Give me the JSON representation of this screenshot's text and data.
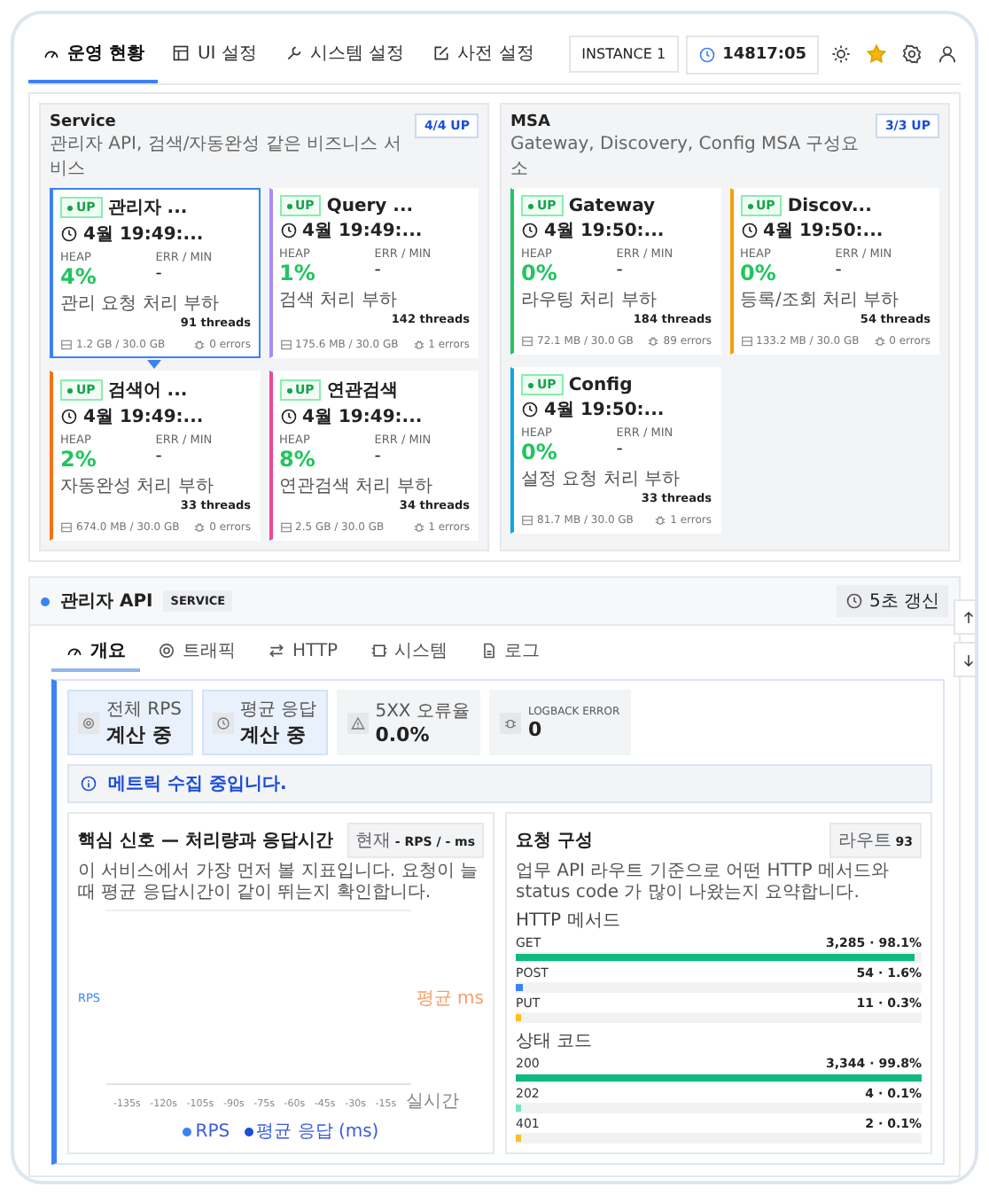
{
  "nav": {
    "tabs": [
      {
        "label": "운영 현황",
        "selected": true
      },
      {
        "label": "UI 설정",
        "selected": false
      },
      {
        "label": "시스템 설정",
        "selected": false
      },
      {
        "label": "사전 설정",
        "selected": false
      }
    ],
    "instance": "INSTANCE 1",
    "clock": "14817:05",
    "favorite": true
  },
  "groups": [
    {
      "title": "Service",
      "description": "관리자 API, 검색/자동완성 같은 비즈니스 서비스",
      "badge": "4/4 UP",
      "services": [
        {
          "status": "UP",
          "name": "관리자 ...",
          "time": "4월 19:49:...",
          "heap_label": "HEAP",
          "heap": "4%",
          "err_label": "ERR / MIN",
          "err": "-",
          "load": "관리 요청 처리 부하",
          "threads": "91 threads",
          "memory": "1.2 GB / 30.0 GB",
          "errors": "0 errors",
          "color": "#3b82f6",
          "selected": true
        },
        {
          "status": "UP",
          "name": "Query ...",
          "time": "4월 19:49:...",
          "heap_label": "HEAP",
          "heap": "1%",
          "err_label": "ERR / MIN",
          "err": "-",
          "load": "검색 처리 부하",
          "threads": "142 threads",
          "memory": "175.6 MB / 30.0 GB",
          "errors": "1 errors",
          "color": "#a78bfa",
          "selected": false
        },
        {
          "status": "UP",
          "name": "검색어 ...",
          "time": "4월 19:49:...",
          "heap_label": "HEAP",
          "heap": "2%",
          "err_label": "ERR / MIN",
          "err": "-",
          "load": "자동완성 처리 부하",
          "threads": "33 threads",
          "memory": "674.0 MB / 30.0 GB",
          "errors": "0 errors",
          "color": "#f97316",
          "selected": false
        },
        {
          "status": "UP",
          "name": "연관검색",
          "time": "4월 19:49:...",
          "heap_label": "HEAP",
          "heap": "8%",
          "err_label": "ERR / MIN",
          "err": "-",
          "load": "연관검색 처리 부하",
          "threads": "34 threads",
          "memory": "2.5 GB / 30.0 GB",
          "errors": "1 errors",
          "color": "#ec4899",
          "selected": false
        }
      ]
    },
    {
      "title": "MSA",
      "description": "Gateway, Discovery, Config MSA 구성요소",
      "badge": "3/3 UP",
      "services": [
        {
          "status": "UP",
          "name": "Gateway",
          "time": "4월 19:50:...",
          "heap_label": "HEAP",
          "heap": "0%",
          "err_label": "ERR / MIN",
          "err": "-",
          "load": "라우팅 처리 부하",
          "threads": "184 threads",
          "memory": "72.1 MB / 30.0 GB",
          "errors": "89 errors",
          "color": "#22c55e",
          "selected": false
        },
        {
          "status": "UP",
          "name": "Discov...",
          "time": "4월 19:50:...",
          "heap_label": "HEAP",
          "heap": "0%",
          "err_label": "ERR / MIN",
          "err": "-",
          "load": "등록/조회 처리 부하",
          "threads": "54 threads",
          "memory": "133.2 MB / 30.0 GB",
          "errors": "0 errors",
          "color": "#f59e0b",
          "selected": false
        },
        {
          "status": "UP",
          "name": "Config",
          "time": "4월 19:50:...",
          "heap_label": "HEAP",
          "heap": "0%",
          "err_label": "ERR / MIN",
          "err": "-",
          "load": "설정 요청 처리 부하",
          "threads": "33 threads",
          "memory": "81.7 MB / 30.0 GB",
          "errors": "1 errors",
          "color": "#0ea5e9",
          "selected": false
        }
      ]
    }
  ],
  "detail": {
    "title": "관리자 API",
    "tag": "SERVICE",
    "refresh": "5초 갱신",
    "tabs": [
      {
        "label": "개요",
        "selected": true
      },
      {
        "label": "트래픽",
        "selected": false
      },
      {
        "label": "HTTP",
        "selected": false
      },
      {
        "label": "시스템",
        "selected": false
      },
      {
        "label": "로그",
        "selected": false
      }
    ],
    "stats": [
      {
        "label": "전체 RPS",
        "value": "계산 중",
        "highlighted": true
      },
      {
        "label": "평균 응답",
        "value": "계산 중",
        "highlighted": true
      },
      {
        "label": "5XX 오류율",
        "value": "0.0%",
        "highlighted": false
      },
      {
        "label": "LOGBACK ERROR",
        "value": "0",
        "highlighted": false
      }
    ],
    "notice": "메트릭 수집 중입니다.",
    "signal": {
      "title": "핵심 신호 — 처리량과 응답시간",
      "badge_label": "현재",
      "badge_value": "- RPS / - ms",
      "description": "이 서비스에서 가장 먼저 볼 지표입니다. 요청이 늘 때 평균 응답시간이 같이 뛰는지 확인합니다.",
      "axis_left": "RPS",
      "axis_right": "평균 ms",
      "x_ticks": [
        "-135s",
        "-120s",
        "-105s",
        "-90s",
        "-75s",
        "-60s",
        "-45s",
        "-30s",
        "-15s",
        "실시간"
      ],
      "legend": [
        {
          "label": "RPS",
          "color": "#3b82f6"
        },
        {
          "label": "평균 응답 (ms)",
          "color": "#1d4ed8"
        }
      ]
    },
    "composition": {
      "title": "요청 구성",
      "badge_label": "라우트",
      "badge_value": "93",
      "description": "업무 API 라우트 기준으로 어떤 HTTP 메서드와 status code 가 많이 나왔는지 요약합니다.",
      "sections": [
        {
          "title": "HTTP 메서드",
          "rows": [
            {
              "label": "GET",
              "value": "3,285 · 98.1%",
              "level": 0.981,
              "color": "#10b981"
            },
            {
              "label": "POST",
              "value": "54 · 1.6%",
              "level": 0.016,
              "color": "#3b82f6"
            },
            {
              "label": "PUT",
              "value": "11 · 0.3%",
              "level": 0.003,
              "color": "#fbbf24"
            }
          ]
        },
        {
          "title": "상태 코드",
          "rows": [
            {
              "label": "200",
              "value": "3,344 · 99.8%",
              "level": 0.998,
              "color": "#10b981"
            },
            {
              "label": "202",
              "value": "4 · 0.1%",
              "level": 0.001,
              "color": "#6ee7b7"
            },
            {
              "label": "401",
              "value": "2 · 0.1%",
              "level": 0.001,
              "color": "#fbbf24"
            }
          ]
        }
      ]
    }
  }
}
